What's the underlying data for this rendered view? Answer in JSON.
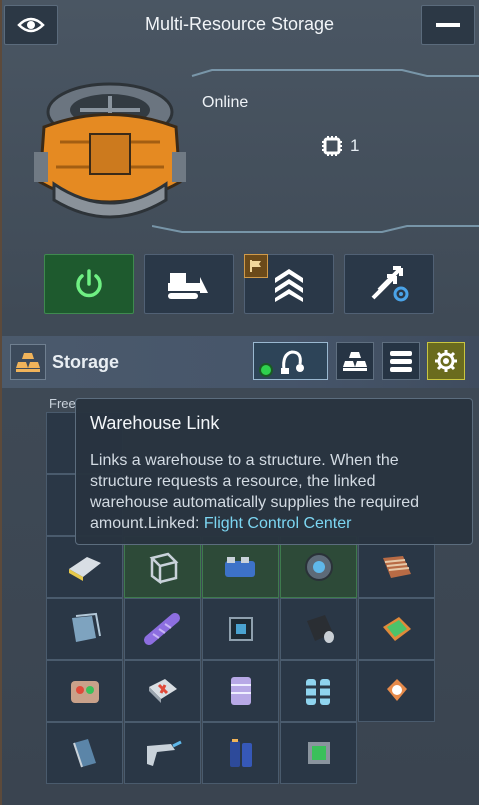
{
  "header": {
    "title": "Multi-Resource Storage",
    "left_icon": "eye-icon",
    "right_icon": "minimize-icon"
  },
  "hero": {
    "status": "Online",
    "chip_count": "1",
    "chip_icon": "chip-icon"
  },
  "actions": [
    {
      "name": "power-button",
      "icon": "power-icon"
    },
    {
      "name": "deconstruct-button",
      "icon": "bulldozer-icon"
    },
    {
      "name": "upgrade-button",
      "icon": "rank-chevron-icon",
      "badge_icon": "flag-icon"
    },
    {
      "name": "transfer-settings-button",
      "icon": "transfer-gear-icon"
    }
  ],
  "storage": {
    "label": "Storage",
    "tools": [
      "warehouse-link-icon",
      "stack-icon",
      "list-icon",
      "gear-icon"
    ],
    "free_label": "Free"
  },
  "tooltip": {
    "title": "Warehouse Link",
    "body": "Links a warehouse to a structure. When the structure requests a resource, the linked warehouse automatically supplies the required amount.",
    "linked_prefix": "Linked: ",
    "linked_value": "Flight Control Center"
  },
  "colors": {
    "accent_green": "#2fd14e",
    "link_color": "#7cd6f2",
    "power_green": "#1e5a2e",
    "gear_yellow": "#c9c640"
  }
}
